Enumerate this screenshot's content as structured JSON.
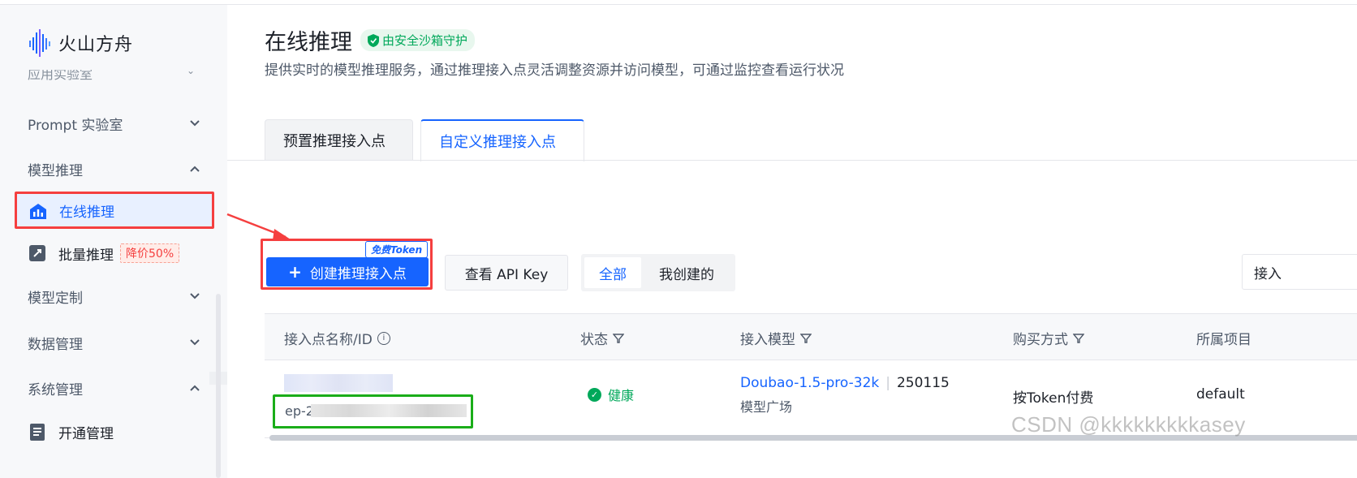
{
  "brand": {
    "name": "火山方舟"
  },
  "sidebar": {
    "cut_item": "应用实验室",
    "groups": [
      {
        "label": "Prompt 实验室",
        "expanded": false
      },
      {
        "label": "模型推理",
        "expanded": true
      },
      {
        "label": "模型定制",
        "expanded": false
      },
      {
        "label": "数据管理",
        "expanded": false
      },
      {
        "label": "系统管理",
        "expanded": true
      }
    ],
    "items": [
      {
        "label": "在线推理",
        "active": true,
        "icon": "bar-chart-icon"
      },
      {
        "label": "批量推理",
        "badge": "降价50%",
        "icon": "rocket-icon"
      },
      {
        "label": "开通管理",
        "icon": "document-icon"
      }
    ]
  },
  "header": {
    "title": "在线推理",
    "badge": "由安全沙箱守护",
    "subtitle": "提供实时的模型推理服务，通过推理接入点灵活调整资源并访问模型，可通过监控查看运行状况"
  },
  "tabs": [
    {
      "label": "预置推理接入点",
      "active": false
    },
    {
      "label": "自定义推理接入点",
      "active": true
    }
  ],
  "toolbar": {
    "create_label": "创建推理接入点",
    "free_badge": "免费Token",
    "apikey_label": "查看 API Key",
    "filter_all": "全部",
    "filter_mine": "我创建的",
    "search_partial": "接入"
  },
  "table": {
    "headers": [
      "接入点名称/ID",
      "状态",
      "接入模型",
      "购买方式",
      "所属项目"
    ],
    "rows": [
      {
        "id_prefix": "ep-2",
        "status": "健康",
        "model": "Doubao-1.5-pro-32k",
        "version": "250115",
        "source": "模型广场",
        "purchase": "按Token付费",
        "project": "default"
      }
    ]
  },
  "watermark": "CSDN @kkkkkkkkkasey",
  "colors": {
    "accent": "#1664ff",
    "success": "#00a85a",
    "highlight": "#f53f3f",
    "id_highlight": "#1aad19"
  }
}
